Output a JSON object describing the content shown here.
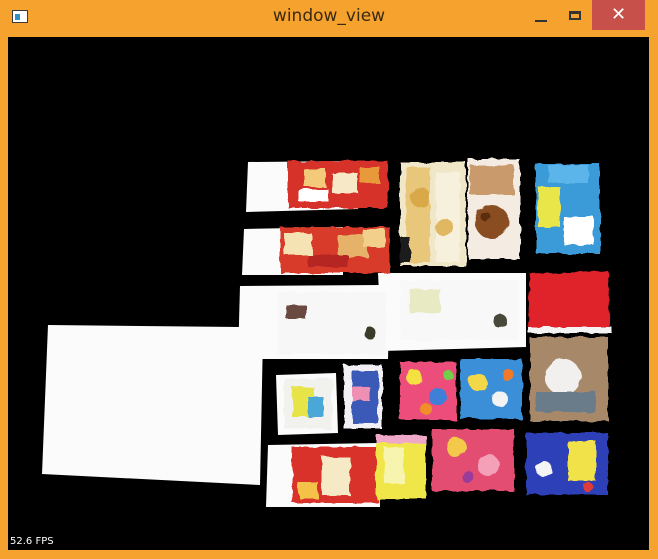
{
  "window": {
    "title": "window_view",
    "close_glyph": "✕"
  },
  "viewport": {
    "fps_label": "52.6 FPS"
  },
  "colors": {
    "frame": "#f6a22e",
    "close_button": "#c7504a",
    "background": "#000000"
  },
  "icons": {
    "app": "app-icon",
    "minimize": "minimize-icon",
    "maximize": "maximize-icon",
    "close": "close-icon"
  }
}
